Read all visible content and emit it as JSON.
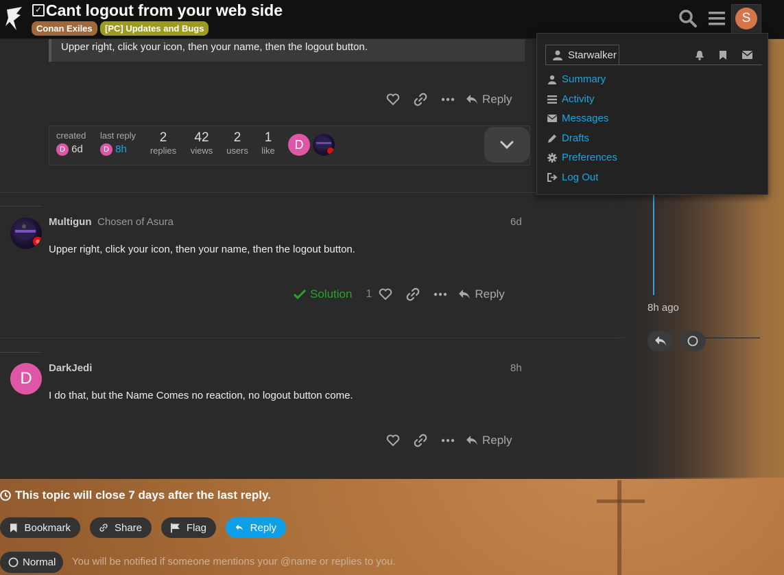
{
  "header": {
    "title": "Cant logout from your web side",
    "categories": [
      "Conan Exiles",
      "[PC] Updates and Bugs"
    ],
    "avatar_letter": "S"
  },
  "quote_text": "Upper right, click your icon, then your name, then the logout button.",
  "post_actions": {
    "reply_label": "Reply"
  },
  "topic_map": {
    "created_label": "created",
    "created_value": "6d",
    "last_reply_label": "last reply",
    "last_reply_value": "8h",
    "replies_count": "2",
    "replies_label": "replies",
    "views_count": "42",
    "views_label": "views",
    "users_count": "2",
    "users_label": "users",
    "likes_count": "1",
    "likes_label": "like",
    "participant_letter": "D"
  },
  "posts": [
    {
      "username": "Multigun",
      "user_title": "Chosen of Asura",
      "date": "6d",
      "text": "Upper right, click your icon, then your name, then the logout button.",
      "solution_label": "Solution",
      "like_count": "1"
    },
    {
      "username": "DarkJedi",
      "avatar_letter": "D",
      "date": "8h",
      "text": "I do that, but the Name Comes no reaction, no logout button come."
    }
  ],
  "timeline": {
    "date": "8h ago"
  },
  "user_menu": {
    "username": "Starwalker",
    "items": [
      "Summary",
      "Activity",
      "Messages",
      "Drafts",
      "Preferences",
      "Log Out"
    ]
  },
  "footer": {
    "close_notice": "This topic will close 7 days after the last reply.",
    "buttons": {
      "bookmark": "Bookmark",
      "share": "Share",
      "flag": "Flag",
      "reply": "Reply"
    },
    "notification_level": "Normal",
    "notification_text": "You will be notified if someone mentions your @name or replies to you."
  },
  "colors": {
    "accent": "#1aa6e4",
    "solution": "#2ba32b",
    "avatar_pink": "#e056a7",
    "avatar_orange": "#d6764b"
  }
}
